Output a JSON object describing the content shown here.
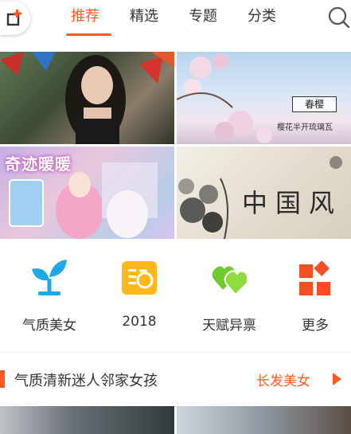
{
  "nav": {
    "tabs": [
      {
        "label": "推荐",
        "active": true
      },
      {
        "label": "精选",
        "active": false
      },
      {
        "label": "专题",
        "active": false
      },
      {
        "label": "分类",
        "active": false
      }
    ],
    "accent": "#ff5a1f"
  },
  "banners": {
    "b2_tag": "春樱",
    "b2_sub": "樱花半开琉璃瓦",
    "b3_title": "奇迹暖暖",
    "b4_title": "中国风"
  },
  "categories": [
    {
      "label": "气质美女",
      "icon": "sprout-icon",
      "color": "#1ea9e6"
    },
    {
      "label": "2018",
      "icon": "calendar-2018-icon",
      "color": "#ffb81c"
    },
    {
      "label": "天赋异禀",
      "icon": "double-heart-icon",
      "color": "#6fcc2c"
    },
    {
      "label": "更多",
      "icon": "more-grid-icon",
      "color": "#f25022"
    }
  ],
  "section": {
    "title": "气质清新迷人邻家女孩",
    "link": "长发美女"
  }
}
